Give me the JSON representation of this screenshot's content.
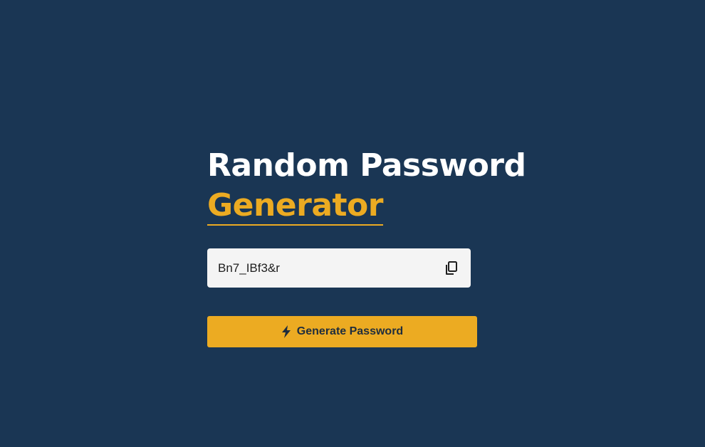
{
  "title": {
    "line1": "Random Password",
    "line2": "Generator"
  },
  "password": {
    "value": "Bn7_IBf3&r",
    "copy_icon": "copy-icon"
  },
  "generate_button": {
    "label": "Generate Password",
    "icon": "bolt-icon"
  },
  "colors": {
    "background": "#1a3654",
    "accent": "#ecab22",
    "input_bg": "#f4f4f4"
  }
}
